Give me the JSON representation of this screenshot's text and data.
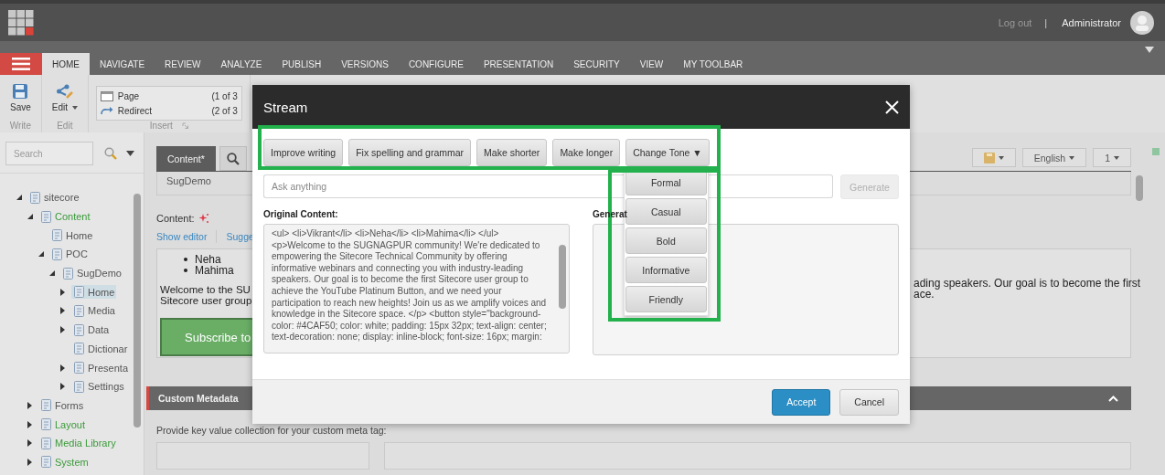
{
  "topbar": {
    "logout": "Log out",
    "separator": "|",
    "user": "Administrator"
  },
  "ribbon_tabs": [
    {
      "label": "HOME",
      "selected": true
    },
    {
      "label": "NAVIGATE",
      "selected": false
    },
    {
      "label": "REVIEW",
      "selected": false
    },
    {
      "label": "ANALYZE",
      "selected": false
    },
    {
      "label": "PUBLISH",
      "selected": false
    },
    {
      "label": "VERSIONS",
      "selected": false
    },
    {
      "label": "CONFIGURE",
      "selected": false
    },
    {
      "label": "PRESENTATION",
      "selected": false
    },
    {
      "label": "SECURITY",
      "selected": false
    },
    {
      "label": "VIEW",
      "selected": false
    },
    {
      "label": "MY TOOLBAR",
      "selected": false
    }
  ],
  "ribbon": {
    "save": "Save",
    "write_group": "Write",
    "edit": "Edit",
    "edit_group": "Edit",
    "insert_items": [
      {
        "label": "Page",
        "count": "(1 of 3"
      },
      {
        "label": "Redirect",
        "count": "(2 of 3"
      }
    ],
    "insert_group": "Insert"
  },
  "sidebar": {
    "search": {
      "placeholder": "Search"
    },
    "tree": [
      {
        "label": "sitecore",
        "expanded": true,
        "selected": false,
        "color": "#555555",
        "children": [
          {
            "label": "Content",
            "expanded": true,
            "selected": false,
            "color": "#3a9a3a",
            "children": [
              {
                "label": "Home",
                "selected": false,
                "color": "#555555"
              },
              {
                "label": "POC",
                "expanded": true,
                "selected": false,
                "color": "#555555",
                "children": [
                  {
                    "label": "SugDemo",
                    "expanded": true,
                    "selected": false,
                    "color": "#555555",
                    "children": [
                      {
                        "label": "Home",
                        "expanded": false,
                        "selected": true,
                        "color": "#555555"
                      },
                      {
                        "label": "Media",
                        "expanded": false,
                        "selected": false,
                        "color": "#555555"
                      },
                      {
                        "label": "Data",
                        "expanded": false,
                        "selected": false,
                        "color": "#555555"
                      },
                      {
                        "label": "Dictionar",
                        "selected": false,
                        "color": "#555555"
                      },
                      {
                        "label": "Presenta",
                        "expanded": false,
                        "selected": false,
                        "color": "#555555"
                      },
                      {
                        "label": "Settings",
                        "expanded": false,
                        "selected": false,
                        "color": "#555555"
                      }
                    ]
                  }
                ]
              }
            ]
          },
          {
            "label": "Forms",
            "expanded": false,
            "selected": false,
            "color": "#555555"
          },
          {
            "label": "Layout",
            "expanded": false,
            "selected": false,
            "color": "#3a9a3a"
          },
          {
            "label": "Media Library",
            "expanded": false,
            "selected": false,
            "color": "#3a9a3a"
          },
          {
            "label": "System",
            "expanded": false,
            "selected": false,
            "color": "#3a9a3a"
          }
        ]
      }
    ]
  },
  "editor": {
    "tabs": [
      {
        "kind": "text",
        "label": "Content*",
        "selected": true
      },
      {
        "kind": "search",
        "selected": false
      }
    ],
    "toolbar": {
      "language": "English",
      "version": "1"
    },
    "item_name": "SugDemo",
    "field_label": "Content:",
    "links": [
      "Show editor",
      "Sugge"
    ],
    "preview": {
      "list": [
        "Neha",
        "Mahima"
      ],
      "left_lines": [
        "Welcome to the SU",
        "Sitecore user group"
      ],
      "button": "Subscribe to",
      "right_lines": [
        "ading speakers. Our goal is to become the first",
        "ace."
      ]
    },
    "section": {
      "title": "Custom Metadata",
      "expanded": true
    },
    "hint": "Provide key value collection for your custom meta tag:"
  },
  "dialog": {
    "title": "Stream",
    "actions": {
      "highlighted": true,
      "buttons": [
        "Improve writing",
        "Fix spelling and grammar",
        "Make shorter",
        "Make longer",
        "Change Tone ▼"
      ]
    },
    "tone_menu": {
      "highlighted": true,
      "options": [
        "Formal",
        "Casual",
        "Bold",
        "Informative",
        "Friendly"
      ]
    },
    "prompt": {
      "placeholder": "Ask anything"
    },
    "generate": {
      "label": "Generate",
      "disabled": true
    },
    "original": {
      "label": "Original Content:",
      "text": "<ul> <li>Vikrant</li> <li>Neha</li> <li>Mahima</li> </ul> <p>Welcome to the SUGNAGPUR community! We're dedicated to empowering the Sitecore Technical Community by offering informative webinars and connecting you with industry-leading speakers. Our goal is to become the first Sitecore user group to achieve the YouTube Platinum Button, and we need your participation to reach new heights! Join us as we amplify voices and knowledge in the Sitecore space. </p> <button style=\"background-color: #4CAF50; color: white; padding: 15px 32px; text-align: center; text-decoration: none; display: inline-block; font-size: 16px; margin:"
    },
    "generated": {
      "label": "Generat"
    },
    "buttons": [
      {
        "label": "Accept",
        "kind": "primary"
      },
      {
        "label": "Cancel",
        "kind": "default"
      }
    ]
  }
}
